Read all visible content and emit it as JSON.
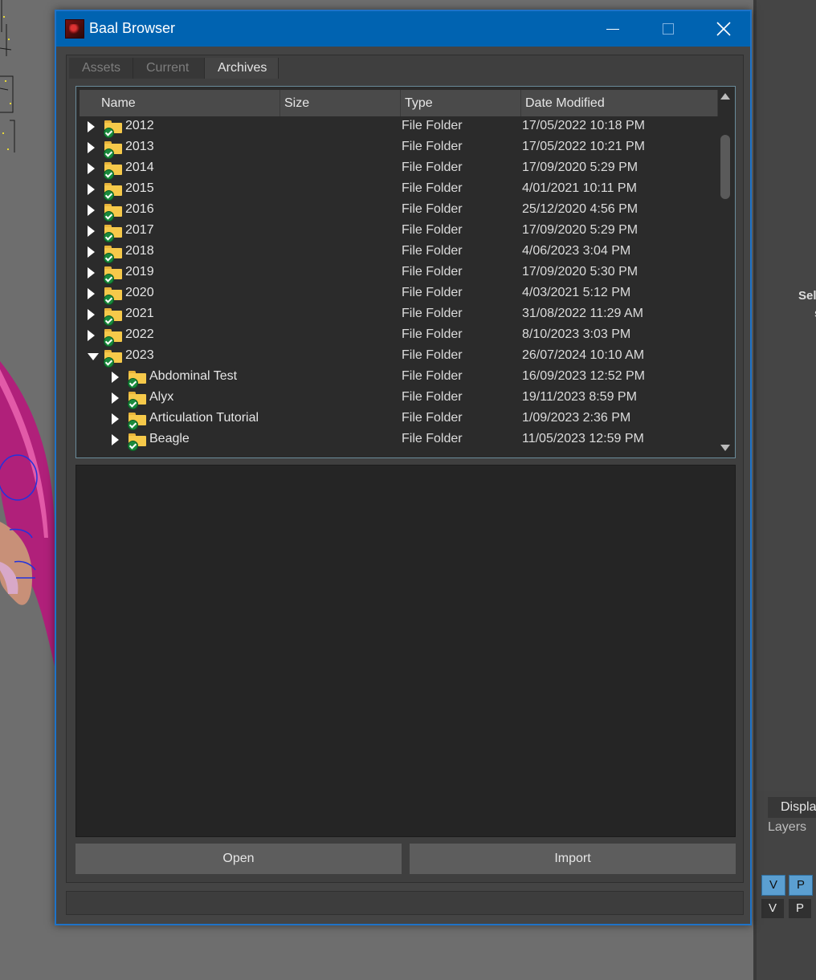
{
  "background_app": {
    "side_label_1": "Sel",
    "side_label_2": "s",
    "display_tab": "Display",
    "layers_tab": "Layers",
    "layer_buttons_row1": [
      "V",
      "P"
    ],
    "layer_buttons_row2": [
      "V",
      "P"
    ]
  },
  "window": {
    "title": "Baal Browser",
    "accent_color": "#0063b1"
  },
  "tabs": [
    {
      "label": "Assets",
      "active": false
    },
    {
      "label": "Current",
      "active": false
    },
    {
      "label": "Archives",
      "active": true
    }
  ],
  "columns": {
    "name": "Name",
    "size": "Size",
    "type": "Type",
    "date": "Date Modified"
  },
  "rows": [
    {
      "name": "2012",
      "type": "File Folder",
      "date": "17/05/2022 10:18 PM",
      "expanded": false,
      "level": 0
    },
    {
      "name": "2013",
      "type": "File Folder",
      "date": "17/05/2022 10:21 PM",
      "expanded": false,
      "level": 0
    },
    {
      "name": "2014",
      "type": "File Folder",
      "date": "17/09/2020 5:29 PM",
      "expanded": false,
      "level": 0
    },
    {
      "name": "2015",
      "type": "File Folder",
      "date": "4/01/2021 10:11 PM",
      "expanded": false,
      "level": 0
    },
    {
      "name": "2016",
      "type": "File Folder",
      "date": "25/12/2020 4:56 PM",
      "expanded": false,
      "level": 0
    },
    {
      "name": "2017",
      "type": "File Folder",
      "date": "17/09/2020 5:29 PM",
      "expanded": false,
      "level": 0
    },
    {
      "name": "2018",
      "type": "File Folder",
      "date": "4/06/2023 3:04 PM",
      "expanded": false,
      "level": 0
    },
    {
      "name": "2019",
      "type": "File Folder",
      "date": "17/09/2020 5:30 PM",
      "expanded": false,
      "level": 0
    },
    {
      "name": "2020",
      "type": "File Folder",
      "date": "4/03/2021 5:12 PM",
      "expanded": false,
      "level": 0
    },
    {
      "name": "2021",
      "type": "File Folder",
      "date": "31/08/2022 11:29 AM",
      "expanded": false,
      "level": 0
    },
    {
      "name": "2022",
      "type": "File Folder",
      "date": "8/10/2023 3:03 PM",
      "expanded": false,
      "level": 0
    },
    {
      "name": "2023",
      "type": "File Folder",
      "date": "26/07/2024 10:10 AM",
      "expanded": true,
      "level": 0
    },
    {
      "name": "Abdominal Test",
      "type": "File Folder",
      "date": "16/09/2023 12:52 PM",
      "expanded": false,
      "level": 1
    },
    {
      "name": "Alyx",
      "type": "File Folder",
      "date": "19/11/2023 8:59 PM",
      "expanded": false,
      "level": 1
    },
    {
      "name": "Articulation Tutorial",
      "type": "File Folder",
      "date": "1/09/2023 2:36 PM",
      "expanded": false,
      "level": 1
    },
    {
      "name": "Beagle",
      "type": "File Folder",
      "date": "11/05/2023 12:59 PM",
      "expanded": false,
      "level": 1
    }
  ],
  "buttons": {
    "open": "Open",
    "import": "Import"
  },
  "icons": {
    "folder": "folder-synced-icon",
    "expand": "chevron-right-icon",
    "collapse": "chevron-down-icon"
  }
}
